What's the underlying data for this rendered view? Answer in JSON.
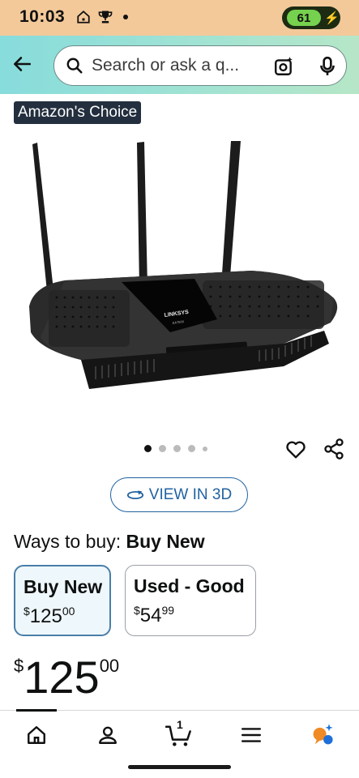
{
  "status_bar": {
    "time": "10:03",
    "battery_level": "61",
    "icons": [
      "home-status-icon",
      "trophy-status-icon",
      "dot-status-icon",
      "charging-bolt-icon"
    ]
  },
  "header": {
    "back_icon": "back-arrow-icon",
    "search": {
      "placeholder": "Search or ask a q...",
      "icons": [
        "search-icon",
        "camera-lens-icon",
        "microphone-icon"
      ]
    }
  },
  "badge": {
    "label": "Amazon's Choice"
  },
  "product": {
    "image_alt": "LINKSYS",
    "image_model_text": "EA7500",
    "carousel": {
      "total": 5,
      "active": 1
    },
    "actions": [
      "heart-icon",
      "share-icon"
    ]
  },
  "view_3d": {
    "label": "VIEW IN 3D",
    "icon": "rotate-3d-icon"
  },
  "ways_to_buy": {
    "prefix": "Ways to buy:",
    "selected": "Buy New",
    "options": [
      {
        "title": "Buy New",
        "currency": "$",
        "whole": "125",
        "cents": "00",
        "selected": true
      },
      {
        "title": "Used - Good",
        "currency": "$",
        "whole": "54",
        "cents": "99",
        "selected": false
      }
    ]
  },
  "price": {
    "currency": "$",
    "whole": "125",
    "cents": "00"
  },
  "bottom_nav": {
    "items": [
      "home-icon",
      "account-icon",
      "cart-icon",
      "menu-icon",
      "rufus-icon"
    ],
    "cart_count": "1"
  },
  "colors": {
    "status_bar": "#f3c99a",
    "header_gradient_start": "#87dcdc",
    "header_gradient_end": "#b6e6c7",
    "badge_bg": "#232f3e",
    "link_blue": "#2162a1",
    "battery_green": "#76d14e"
  }
}
